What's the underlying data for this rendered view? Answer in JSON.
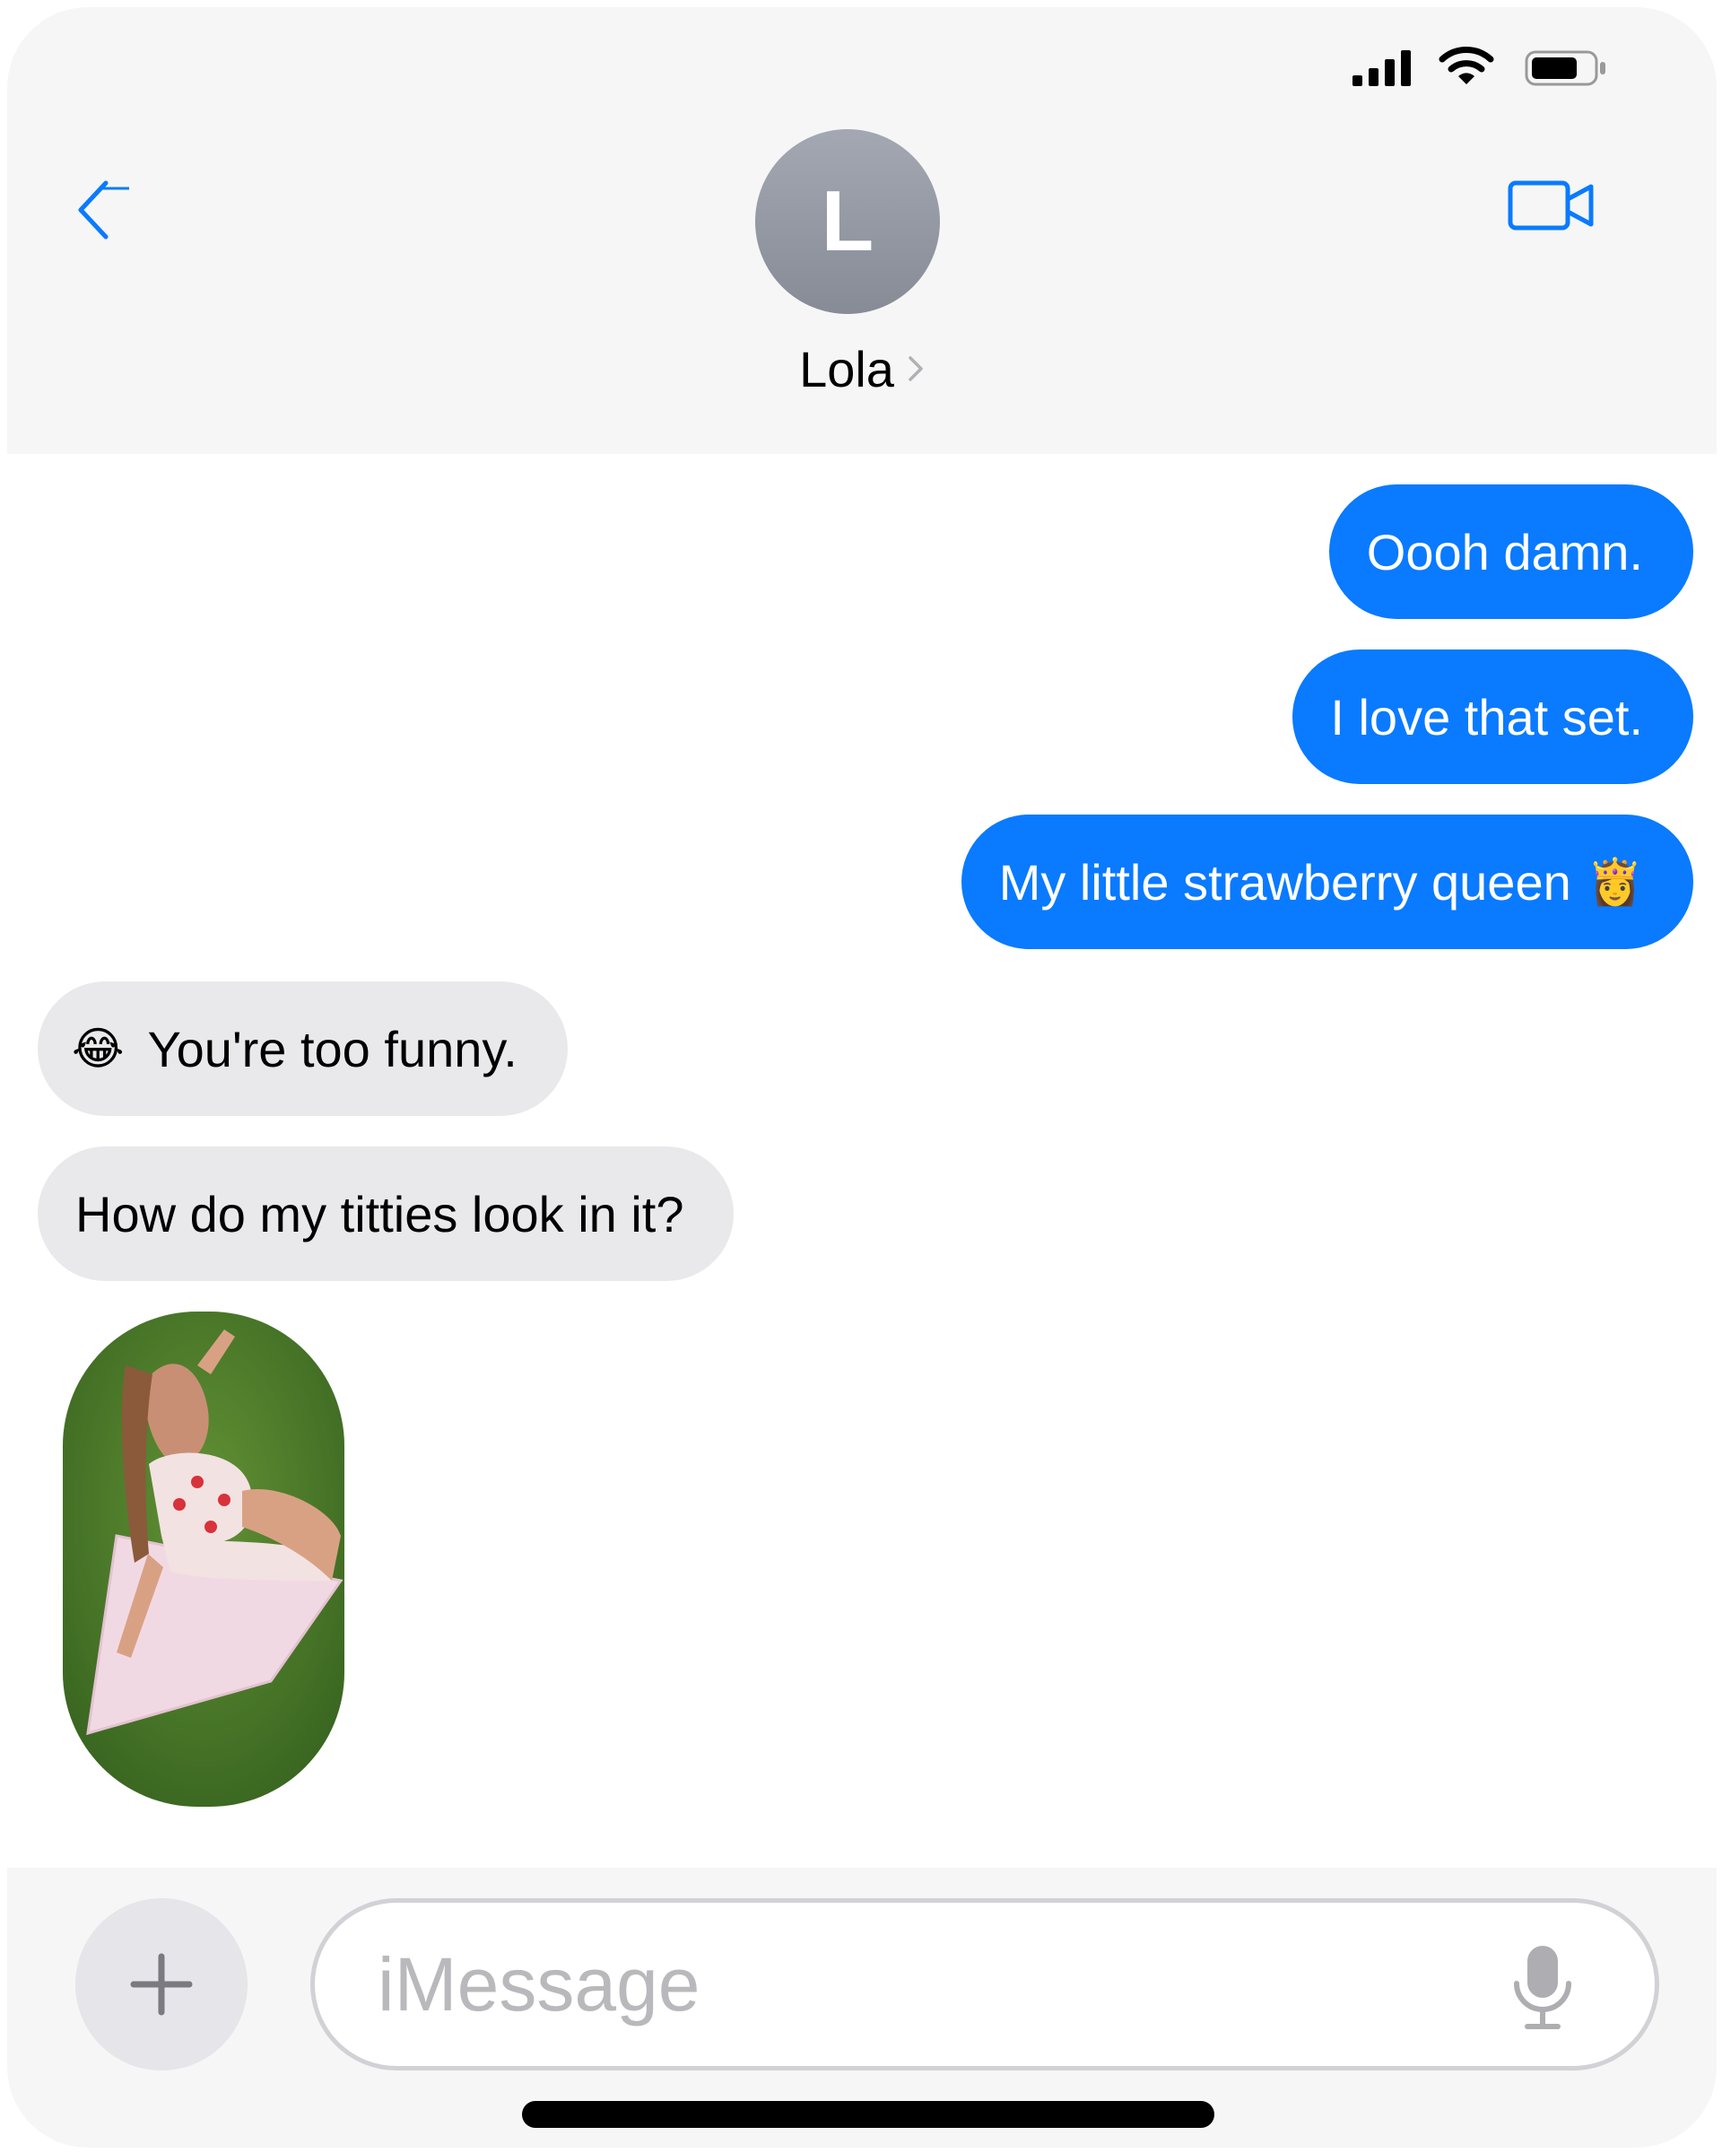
{
  "contact": {
    "initial": "L",
    "name": "Lola"
  },
  "messages": [
    {
      "direction": "sent",
      "text": "Oooh damn."
    },
    {
      "direction": "sent",
      "text": "I love that set."
    },
    {
      "direction": "sent",
      "text": "My little strawberry queen",
      "emoji": "👸"
    },
    {
      "direction": "received",
      "text": "You're too funny.",
      "emoji": "😂"
    },
    {
      "direction": "received",
      "text": "How do my titties look in it?"
    },
    {
      "direction": "received",
      "attachment": "photo"
    }
  ],
  "composer": {
    "placeholder": "iMessage"
  },
  "icons": {
    "back": "chevron-left-icon",
    "video": "video-camera-icon",
    "add": "plus-icon",
    "mic": "microphone-icon",
    "signal": "cellular-signal-icon",
    "wifi": "wifi-icon",
    "battery": "battery-icon"
  },
  "colors": {
    "sent_bubble": "#0a7aff",
    "received_bubble": "#e9e9eb",
    "accent": "#0a7aff",
    "header_bg": "#f6f6f6"
  }
}
